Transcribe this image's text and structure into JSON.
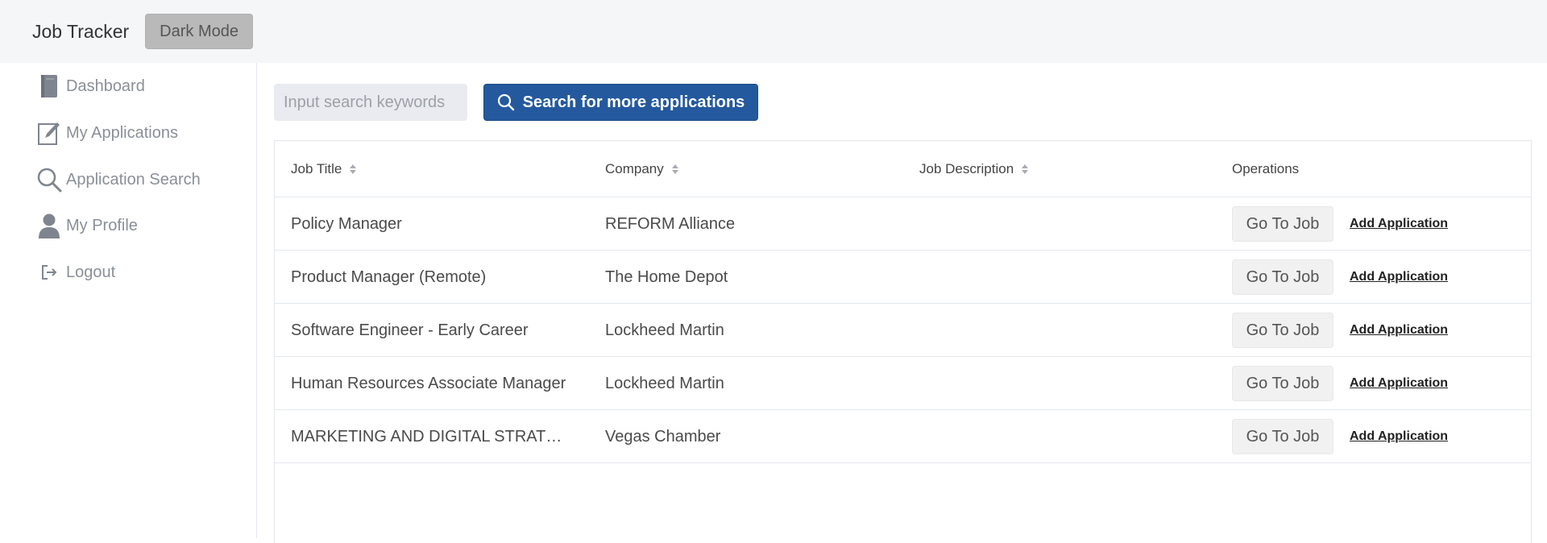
{
  "header": {
    "title": "Job Tracker",
    "dark_mode_label": "Dark Mode"
  },
  "sidebar": {
    "items": [
      {
        "label": "Dashboard",
        "icon": "book-icon"
      },
      {
        "label": "My Applications",
        "icon": "edit-icon"
      },
      {
        "label": "Application Search",
        "icon": "search-icon"
      },
      {
        "label": "My Profile",
        "icon": "user-icon"
      },
      {
        "label": "Logout",
        "icon": "logout-icon"
      }
    ]
  },
  "search": {
    "placeholder": "Input search keywords",
    "value": "",
    "button_label": "Search for more applications"
  },
  "table": {
    "columns": [
      "Job Title",
      "Company",
      "Job Description",
      "Operations"
    ],
    "rows": [
      {
        "title": "Policy Manager",
        "company": "REFORM Alliance",
        "description": ""
      },
      {
        "title": "Product Manager (Remote)",
        "company": "The Home Depot",
        "description": ""
      },
      {
        "title": "Software Engineer - Early Career",
        "company": "Lockheed Martin",
        "description": ""
      },
      {
        "title": "Human Resources Associate Manager",
        "company": "Lockheed Martin",
        "description": ""
      },
      {
        "title": "MARKETING AND DIGITAL STRATEGY",
        "company": "Vegas Chamber",
        "description": ""
      }
    ],
    "go_to_job_label": "Go To Job",
    "add_application_label": "Add Application"
  },
  "colors": {
    "primary": "#24599e",
    "header_bg": "#f5f6f8",
    "dark_mode_button": "#b9b9b9"
  }
}
